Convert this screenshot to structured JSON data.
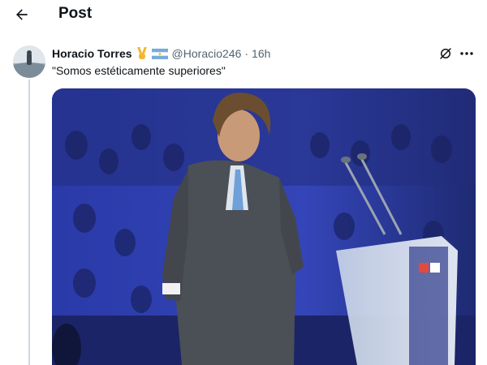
{
  "header": {
    "title": "Post",
    "back_icon": "arrow-left-icon"
  },
  "post": {
    "author_name": "Horacio Torres",
    "badges": [
      "victory-hand-emoji",
      "argentina-flag-emoji"
    ],
    "handle": "@Horacio246",
    "separator": "·",
    "time": "16h",
    "text": "\"Somos estéticamente superiores\"",
    "actions": [
      "grok-icon",
      "more-options-icon"
    ]
  },
  "colors": {
    "text": "#0f1419",
    "secondary": "#536471",
    "thread_line": "#cfd9de",
    "stage_blue": "#2a3aa8"
  }
}
